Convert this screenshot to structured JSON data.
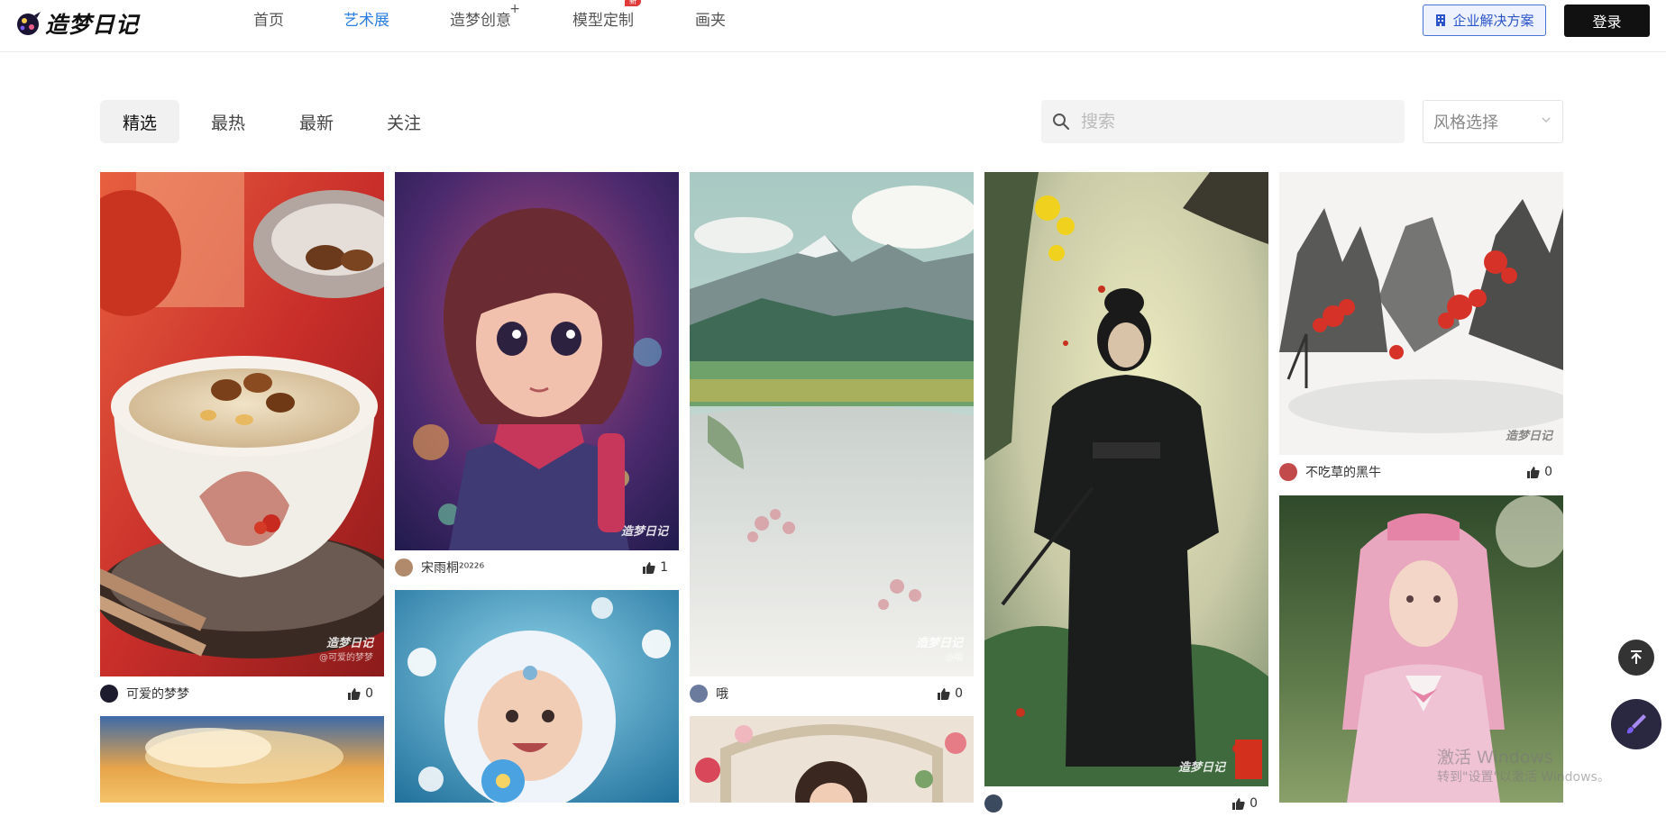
{
  "header": {
    "logo_text": "造梦日记",
    "nav": [
      {
        "label": "首页",
        "active": false,
        "mark": null
      },
      {
        "label": "艺术展",
        "active": true,
        "mark": null
      },
      {
        "label": "造梦创意",
        "active": false,
        "mark": "+"
      },
      {
        "label": "模型定制",
        "active": false,
        "mark": "new"
      },
      {
        "label": "画夹",
        "active": false,
        "mark": null
      }
    ],
    "enterprise_label": "企业解决方案",
    "login_label": "登录",
    "accent_color": "#2a7de1"
  },
  "filters": {
    "tabs": [
      {
        "label": "精选",
        "active": true
      },
      {
        "label": "最热",
        "active": false
      },
      {
        "label": "最新",
        "active": false
      },
      {
        "label": "关注",
        "active": false
      }
    ],
    "search_placeholder": "搜索",
    "style_select_label": "风格选择"
  },
  "gallery": {
    "watermark_brand": "造梦日记",
    "cards": [
      {
        "author": "可爱的梦梦",
        "likes": "0",
        "watermark_user": "@可爱的梦梦",
        "subject": "nut porridge bowl"
      },
      {
        "author": "宋雨桐²⁰²²⁶",
        "likes": "1",
        "watermark_user": "",
        "subject": "cartoon girl"
      },
      {
        "author": "",
        "likes": "",
        "watermark_user": "",
        "subject": "baby in fur hood"
      },
      {
        "author": "哦",
        "likes": "0",
        "watermark_user": "@哦",
        "subject": "misty mountain landscape"
      },
      {
        "author": "",
        "likes": "",
        "watermark_user": "",
        "subject": "floral arch portrait"
      },
      {
        "author": "",
        "likes": "0",
        "watermark_user": "",
        "subject": "warrior in black robe"
      },
      {
        "author": "不吃草的黑牛",
        "likes": "0",
        "watermark_user": "",
        "subject": "ink wash mountains"
      },
      {
        "author": "",
        "likes": "",
        "watermark_user": "",
        "subject": "pink haired girl"
      },
      {
        "author": "",
        "likes": "",
        "watermark_user": "",
        "subject": "sunset clouds"
      }
    ]
  },
  "floating": {
    "back_to_top_icon": "arrow-up-to-line-icon",
    "create_icon": "brush-icon"
  },
  "system_watermark": {
    "line1": "激活 Windows",
    "line2": "转到\"设置\"以激活 Windows。"
  }
}
